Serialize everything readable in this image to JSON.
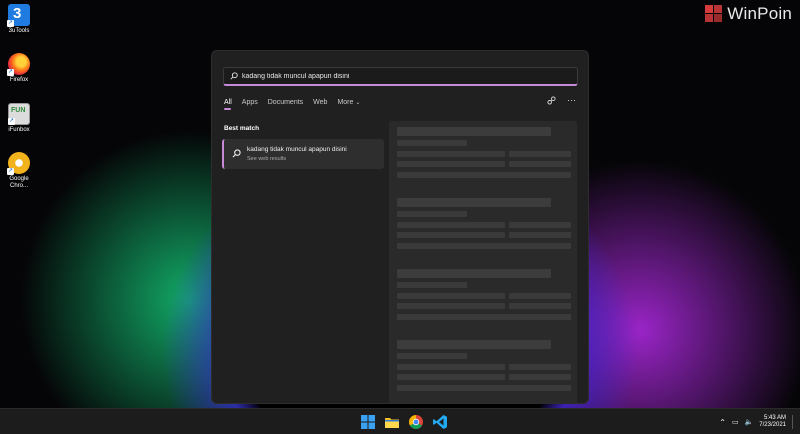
{
  "desktop": {
    "icons": [
      {
        "label": "3uTools"
      },
      {
        "label": "Firefox"
      },
      {
        "label": "iFunbox"
      },
      {
        "label": "Google Chro..."
      }
    ],
    "watermark": "WinPoin"
  },
  "search": {
    "query": "kadang tidak muncul apapun disini",
    "tabs": [
      "All",
      "Apps",
      "Documents",
      "Web",
      "More"
    ],
    "active_tab": "All",
    "best_match_label": "Best match",
    "result": {
      "title": "kadang tidak muncul apapun disini",
      "subtitle": "See web results"
    }
  },
  "taskbar": {
    "apps": [
      "start-icon",
      "file-explorer-icon",
      "chrome-icon",
      "vscode-icon"
    ],
    "tray": {
      "time": "5:43 AM",
      "date": "7/23/2021"
    }
  },
  "colors": {
    "accent": "#c88ad8",
    "panel": "#202020",
    "taskbar": "#1c1c1c"
  }
}
